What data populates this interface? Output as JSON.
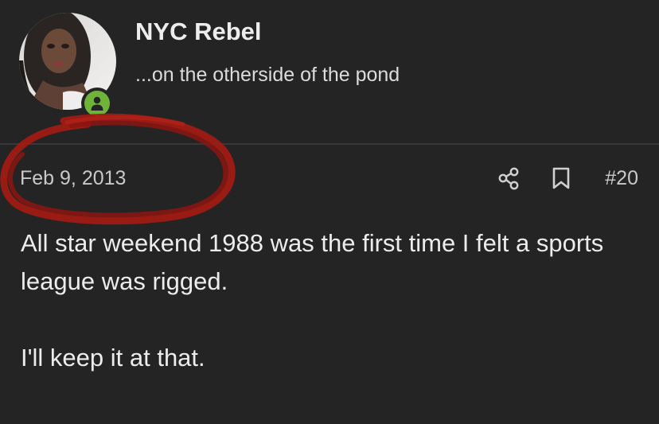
{
  "user": {
    "name": "NYC Rebel",
    "title": "...on the otherside of the pond",
    "avatar_icon": "user-avatar-photo",
    "status_icon": "online-status-icon",
    "status_color": "#6fb33a"
  },
  "post": {
    "date": "Feb 9, 2013",
    "number": "#20",
    "share_icon": "share-icon",
    "bookmark_icon": "bookmark-icon",
    "paragraphs": [
      "All star weekend 1988 was the first time I felt a sports league was rigged.",
      "I'll keep it at that."
    ]
  },
  "annotation": {
    "color": "#a31b14"
  },
  "theme": {
    "background": "#242424",
    "divider": "#383838"
  }
}
